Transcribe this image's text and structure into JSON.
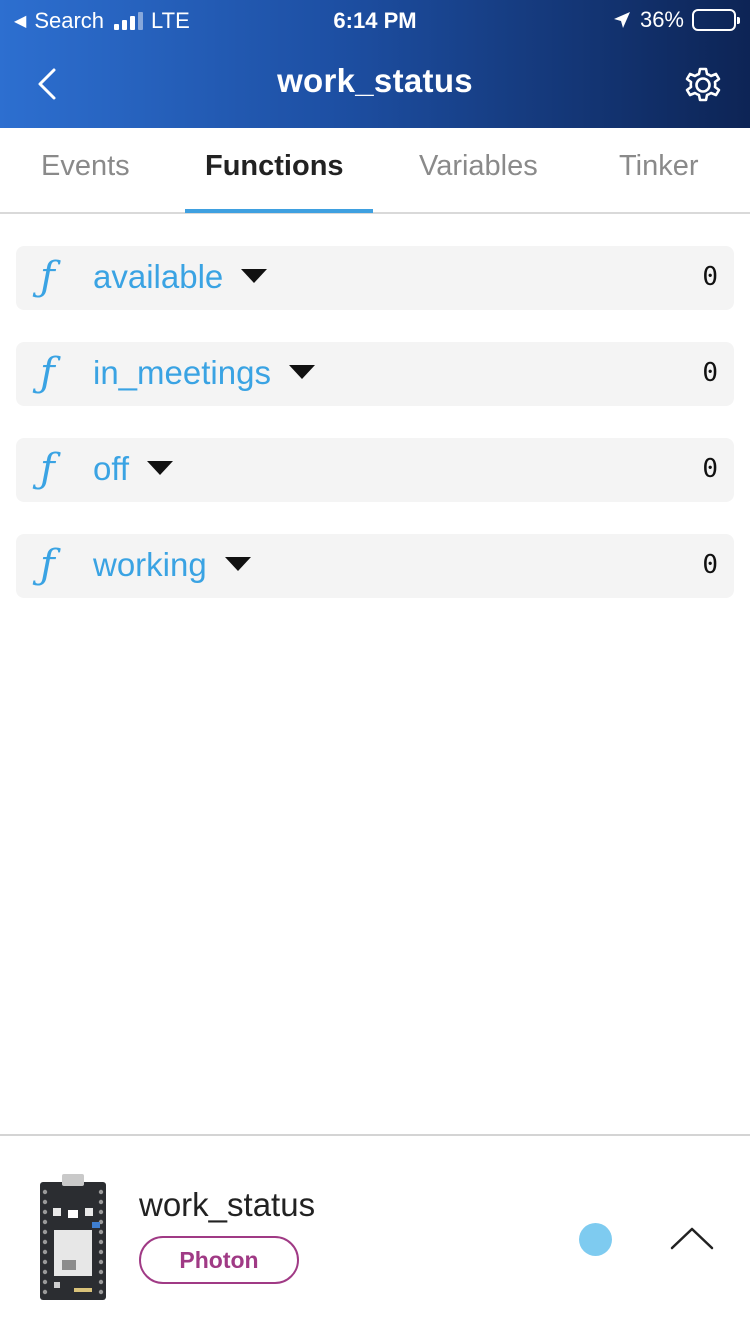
{
  "status_bar": {
    "back_app": "Search",
    "network": "LTE",
    "time": "6:14 PM",
    "battery": "36%",
    "battery_level": 0.36
  },
  "header": {
    "title": "work_status",
    "back_icon": "chevron-left-icon",
    "settings_icon": "gear-icon"
  },
  "tabs": [
    {
      "label": "Events",
      "active": false
    },
    {
      "label": "Functions",
      "active": true
    },
    {
      "label": "Variables",
      "active": false
    },
    {
      "label": "Tinker",
      "active": false
    }
  ],
  "functions": [
    {
      "icon": "ƒ",
      "name": "available",
      "value": "0"
    },
    {
      "icon": "ƒ",
      "name": "in_meetings",
      "value": "0"
    },
    {
      "icon": "ƒ",
      "name": "off",
      "value": "0"
    },
    {
      "icon": "ƒ",
      "name": "working",
      "value": "0"
    }
  ],
  "device": {
    "name": "work_status",
    "type": "Photon",
    "status_color": "#7ecbf0",
    "icon": "chevron-up-icon"
  },
  "colors": {
    "accent": "#3aa3e3",
    "header_start": "#2d6fd0",
    "header_end": "#0d2455",
    "badge": "#a03a85"
  }
}
